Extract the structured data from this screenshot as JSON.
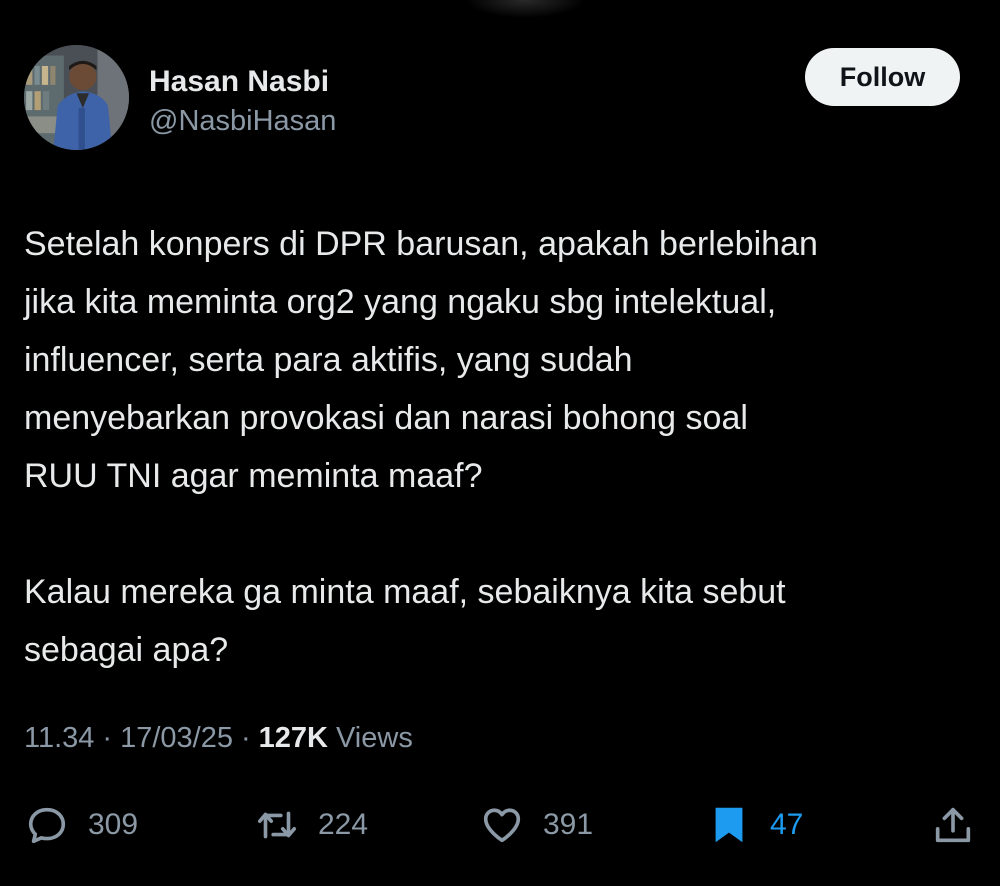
{
  "user": {
    "display_name": "Hasan Nasbi",
    "handle": "@NasbiHasan",
    "follow_label": "Follow"
  },
  "tweet": {
    "paragraph1": "Setelah konpers di DPR barusan, apakah berlebihan jika kita meminta org2 yang ngaku sbg intelektual, influencer, serta para aktifis, yang sudah menyebarkan provokasi dan narasi bohong soal RUU TNI agar meminta maaf?",
    "paragraph1_lines": [
      "Setelah konpers di DPR barusan, apakah berlebihan",
      "jika kita meminta org2 yang ngaku sbg intelektual,",
      "influencer, serta para aktifis, yang sudah",
      "menyebarkan provokasi dan narasi bohong soal",
      "RUU TNI agar meminta maaf?"
    ],
    "paragraph2_lines": [
      "Kalau mereka ga minta maaf, sebaiknya kita sebut",
      "sebagai apa?"
    ]
  },
  "meta": {
    "time": "11.34",
    "separator": "·",
    "date": "17/03/25",
    "views_count": "127K",
    "views_label": "Views"
  },
  "actions": {
    "replies": "309",
    "reposts": "224",
    "likes": "391",
    "bookmarks": "47"
  },
  "icons": {
    "reply": "reply-icon",
    "repost": "repost-icon",
    "like": "heart-icon",
    "bookmark": "bookmark-icon",
    "share": "share-icon"
  },
  "colors": {
    "background": "#000000",
    "text": "#e7e9ea",
    "secondary": "#8b98a5",
    "accent": "#1d9bf0",
    "follow_bg": "#eff3f4"
  }
}
